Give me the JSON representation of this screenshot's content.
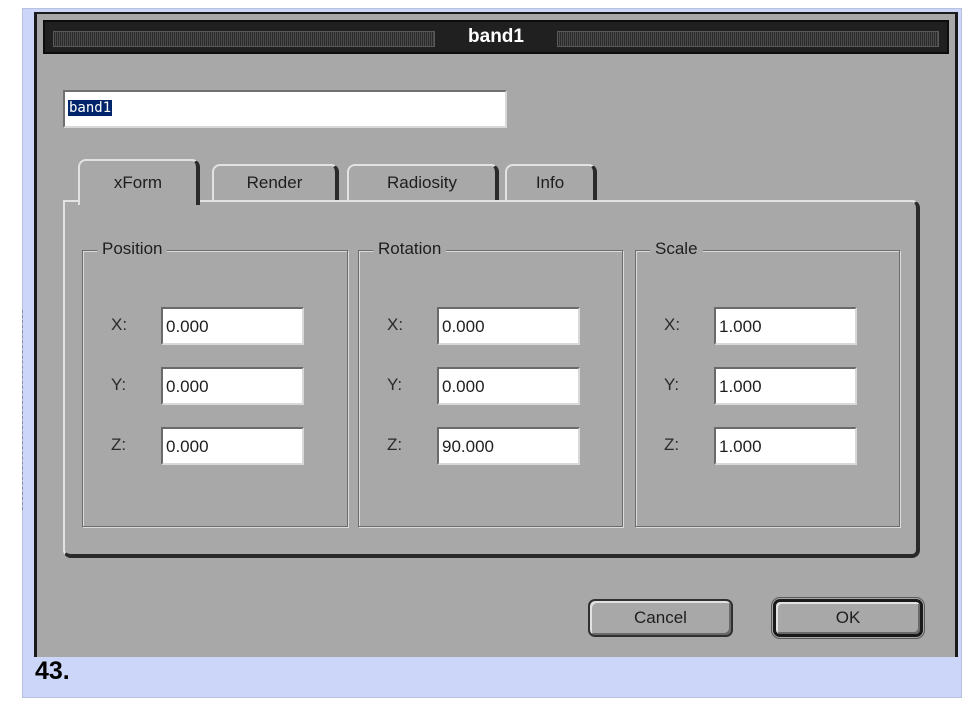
{
  "window": {
    "title": "band1"
  },
  "name_field": {
    "value": "band1"
  },
  "tabs": [
    {
      "label": "xForm",
      "active": true
    },
    {
      "label": "Render",
      "active": false
    },
    {
      "label": "Radiosity",
      "active": false
    },
    {
      "label": "Info",
      "active": false
    }
  ],
  "groups": {
    "position": {
      "label": "Position",
      "x_label": "X:",
      "x": "0.000",
      "y_label": "Y:",
      "y": "0.000",
      "z_label": "Z:",
      "z": "0.000"
    },
    "rotation": {
      "label": "Rotation",
      "x_label": "X:",
      "x": "0.000",
      "y_label": "Y:",
      "y": "0.000",
      "z_label": "Z:",
      "z": "90.000"
    },
    "scale": {
      "label": "Scale",
      "x_label": "X:",
      "x": "1.000",
      "y_label": "Y:",
      "y": "1.000",
      "z_label": "Z:",
      "z": "1.000"
    }
  },
  "buttons": {
    "cancel": "Cancel",
    "ok": "OK"
  },
  "caption": "43.",
  "colors": {
    "dialog_bg": "#a8a8a8",
    "title_bg": "#202020",
    "selection": "#00246a",
    "frame_bg": "#ccd6f8"
  }
}
